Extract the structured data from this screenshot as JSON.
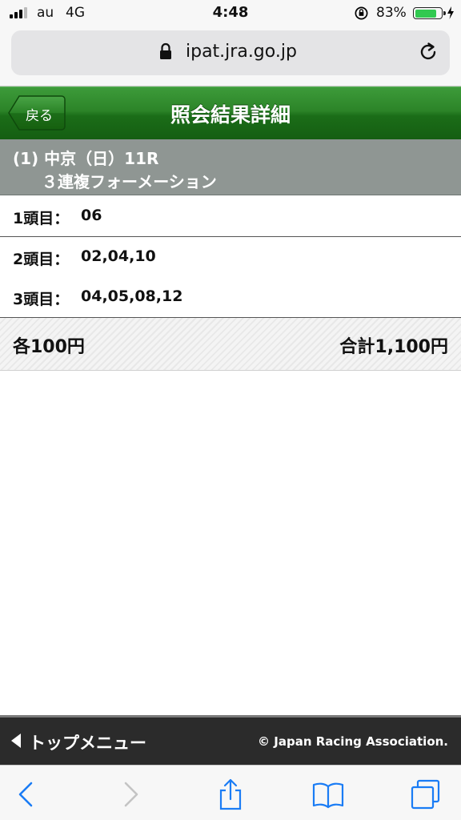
{
  "status_bar": {
    "carrier": "au",
    "network": "4G",
    "time": "4:48",
    "battery_percent": "83%",
    "battery_level": 0.83,
    "icons": [
      "signal-icon",
      "orientation-lock-icon",
      "battery-icon",
      "charging-bolt-icon"
    ]
  },
  "browser": {
    "url": "ipat.jra.go.jp",
    "icons": [
      "lock-icon",
      "reload-icon"
    ]
  },
  "header": {
    "back_label": "戻る",
    "title": "照会結果詳細",
    "accent_color": "#1f7a1b"
  },
  "race": {
    "line1": "(1) 中京（日）11R",
    "line2": "３連複フォーメーション"
  },
  "selections": [
    {
      "label": "1頭目：",
      "value": "06"
    },
    {
      "label": "2頭目：",
      "value": "02,04,10"
    },
    {
      "label": "3頭目：",
      "value": "04,05,08,12"
    }
  ],
  "totals": {
    "unit": "各100円",
    "total": "合計1,100円"
  },
  "footer": {
    "menu_label": "トップメニュー",
    "copyright": "© Japan Racing Association."
  },
  "toolbar": {
    "icons": [
      "back-icon",
      "forward-icon",
      "share-icon",
      "bookmarks-icon",
      "tabs-icon"
    ]
  }
}
